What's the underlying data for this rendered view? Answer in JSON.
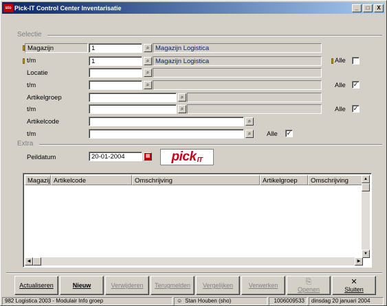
{
  "window": {
    "title": "Pick-IT Control Center Inventarisatie",
    "app_icon_text": "sto",
    "controls": [
      "_",
      "□",
      "X"
    ]
  },
  "selectie": {
    "title": "Selectie",
    "rows": [
      {
        "label": "Magazijn",
        "value": "1",
        "desc": "Magazijn Logistica"
      },
      {
        "label": "t/m",
        "value": "1",
        "desc": "Magazijn Logistica"
      },
      {
        "label": "Locatie",
        "value": "",
        "desc": ""
      },
      {
        "label": "t/m",
        "value": "",
        "desc": ""
      },
      {
        "label": "Artikelgroep",
        "value": "",
        "desc": ""
      },
      {
        "label": "t/m",
        "value": "",
        "desc": ""
      },
      {
        "label": "Artikelcode",
        "value": "",
        "desc": ""
      },
      {
        "label": "t/m",
        "value": "",
        "desc": ""
      }
    ],
    "alle_label": "Alle",
    "alle_magazijn_checked": false,
    "alle_locatie_checked": true,
    "alle_artikelgroep_checked": true,
    "alle_artikelcode_checked": true
  },
  "extra": {
    "title": "Extra",
    "peildatum_label": "Peildatum",
    "peildatum_value": "20-01-2004",
    "calendar_icon": "calendar-icon",
    "logo_text": "pick",
    "logo_sub": "IT"
  },
  "grid": {
    "columns": [
      "Magazijn",
      "Artikelcode",
      "Omschrijving",
      "Artikelgroep",
      "Omschrijving"
    ],
    "rows": []
  },
  "toolbar": {
    "buttons": [
      {
        "label": "Actualiseren",
        "enabled": true
      },
      {
        "label": "Nieuw",
        "enabled": true
      },
      {
        "label": "Verwijderen",
        "enabled": false
      },
      {
        "label": "Terugmelden",
        "enabled": false
      },
      {
        "label": "Vergelijken",
        "enabled": false
      },
      {
        "label": "Verwerken",
        "enabled": false
      },
      {
        "label": "Openen",
        "enabled": false
      },
      {
        "label": "Sluiten",
        "enabled": true
      }
    ]
  },
  "statusbar": {
    "company": "982 Logistica 2003 - Modulair Info groep",
    "user": "Stan Houben (sho)",
    "code": "1006009533",
    "date": "dinsdag 20 januari 2004"
  }
}
